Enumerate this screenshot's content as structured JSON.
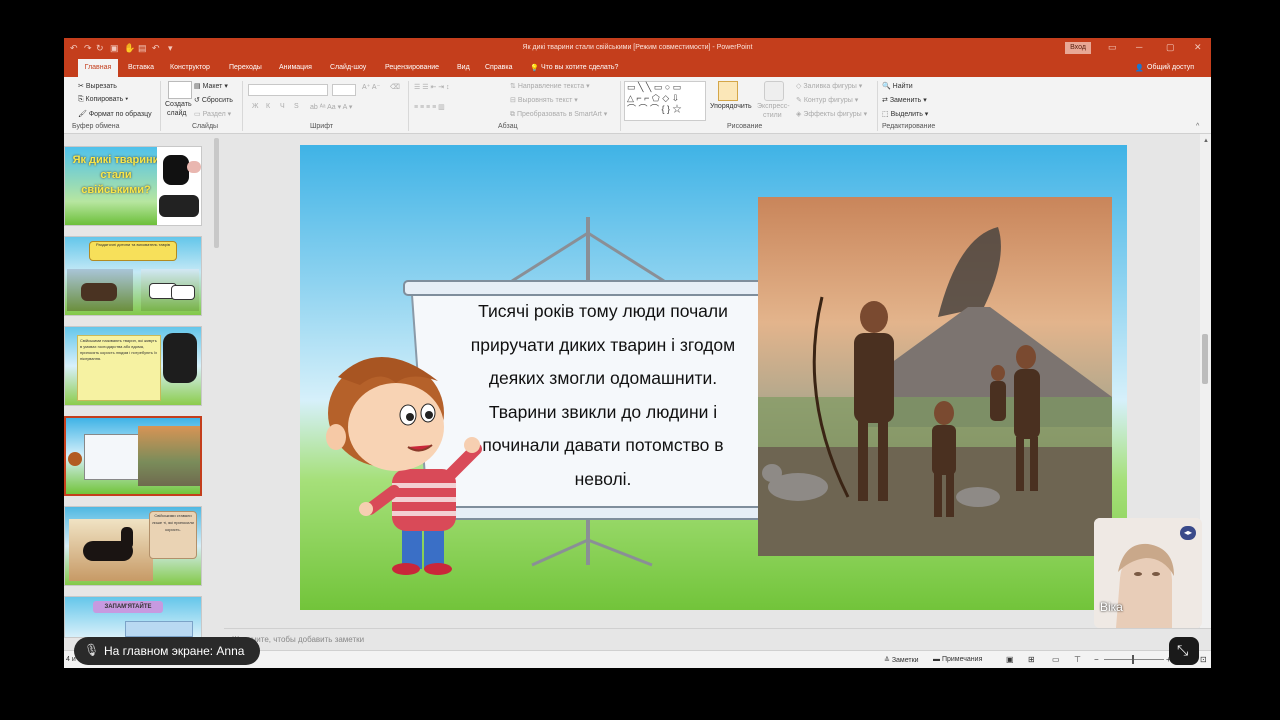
{
  "window": {
    "doc_title": "Як дикі тварини стали свійськими [Режим совместимости] - PowerPoint",
    "sign_in": "Вход",
    "help_search": "Что вы хотите сделать?",
    "share": "Общий доступ"
  },
  "tabs": [
    "Главная",
    "Вставка",
    "Конструктор",
    "Переходы",
    "Анимация",
    "Слайд-шоу",
    "Рецензирование",
    "Вид",
    "Справка"
  ],
  "ribbon": {
    "clipboard": {
      "cut": "Вырезать",
      "copy": "Копировать",
      "format_painter": "Формат по образцу",
      "group": "Буфер обмена"
    },
    "slides": {
      "new_slide_1": "Создать",
      "new_slide_2": "слайд",
      "layout": "Макет",
      "reset": "Сбросить",
      "section": "Раздел",
      "group": "Слайды"
    },
    "font": {
      "group": "Шрифт",
      "bold": "Ж",
      "italic": "К",
      "underline": "Ч",
      "strike": "S"
    },
    "paragraph": {
      "text_direction": "Направление текста",
      "align_text": "Выровнять текст",
      "smartart": "Преобразовать в SmartArt",
      "group": "Абзац"
    },
    "drawing": {
      "arrange": "Упорядочить",
      "quick_styles_1": "Экспресс-",
      "quick_styles_2": "стили",
      "fill": "Заливка фигуры",
      "outline": "Контур фигуры",
      "effects": "Эффекты фигуры",
      "group": "Рисование"
    },
    "editing": {
      "find": "Найти",
      "replace": "Заменить",
      "select": "Выделить",
      "group": "Редактирование"
    }
  },
  "thumbnails": {
    "t1_title": "Як дикі тварини стали свійськими?",
    "t2_text": "Раздаточні дитини та вихователь таврів",
    "t3_text": "Свійськими називають тварин, які живуть в умовах господарства або вдома, приносять користь людям і потребують їх піклування.",
    "t5_text": "Свійськими ставали лише ті, які приносили користь.",
    "t6_label": "ЗАПАМ'ЯТАЙТЕ"
  },
  "slide": {
    "board_text": [
      "Тисячі років тому люди почали",
      "приручати диких тварин і згодом",
      "деяких змогли одомашнити.",
      "Тварини звикли до людини і",
      "починали давати потомство в",
      "неволі."
    ]
  },
  "notes_placeholder": "Щелкните, чтобы добавить заметки",
  "status": {
    "slide_info": "4 и",
    "notes": "Заметки",
    "comments": "Примечания"
  },
  "overlay": {
    "share_text": "На главном экране: Anna",
    "participant_name": "Віка"
  },
  "colors": {
    "ppt_red": "#c43e1c",
    "selected_thumb": "#c43e1c"
  }
}
